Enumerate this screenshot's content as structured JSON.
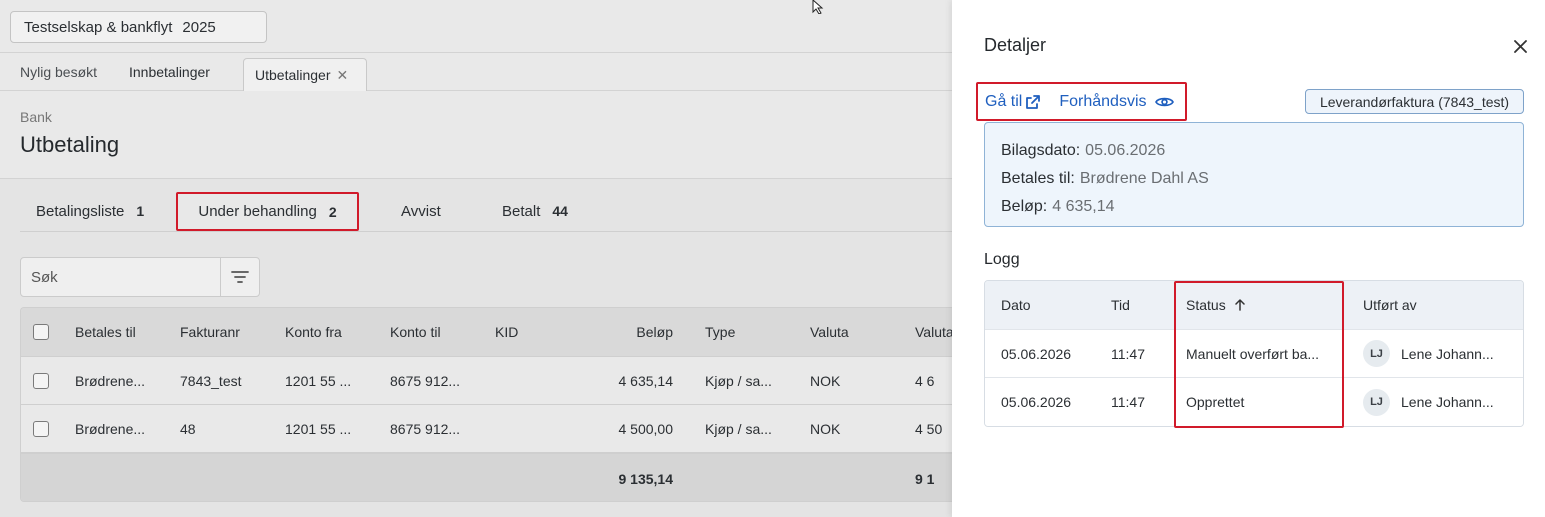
{
  "company": {
    "name": "Testselskap & bankflyt",
    "year": "2025"
  },
  "nav_tabs": [
    {
      "label": "Nylig besøkt"
    },
    {
      "label": "Innbetalinger"
    },
    {
      "label": "Utbetalinger"
    }
  ],
  "breadcrumb": "Bank",
  "page_title": "Utbetaling",
  "sub_tabs": [
    {
      "label": "Betalingsliste",
      "count": "1"
    },
    {
      "label": "Under behandling",
      "count": "2"
    },
    {
      "label": "Avvist",
      "count": ""
    },
    {
      "label": "Betalt",
      "count": "44"
    }
  ],
  "search": {
    "placeholder": "Søk"
  },
  "grid": {
    "columns": [
      "Betales til",
      "Fakturanr",
      "Konto fra",
      "Konto til",
      "KID",
      "Beløp",
      "Type",
      "Valuta",
      "Valuta"
    ],
    "rows": [
      {
        "betales_til": "Brødrene...",
        "fakturanr": "7843_test",
        "konto_fra": "1201 55 ...",
        "konto_til": "8675 912...",
        "kid": "",
        "belop": "4 635,14",
        "type": "Kjøp / sa...",
        "valuta": "NOK",
        "valuta2": "4 6"
      },
      {
        "betales_til": "Brødrene...",
        "fakturanr": "48",
        "konto_fra": "1201 55 ...",
        "konto_til": "8675 912...",
        "kid": "",
        "belop": "4 500,00",
        "type": "Kjøp / sa...",
        "valuta": "NOK",
        "valuta2": "4 50"
      }
    ],
    "sum": {
      "belop": "9 135,14",
      "valuta2": "9 1"
    }
  },
  "details": {
    "title": "Detaljer",
    "goto_label": "Gå til",
    "preview_label": "Forhåndsvis",
    "badge": "Leverandørfaktura (7843_test)",
    "info": [
      {
        "label": "Bilagsdato:",
        "value": "05.06.2026"
      },
      {
        "label": "Betales til:",
        "value": "Brødrene Dahl AS"
      },
      {
        "label": "Beløp:",
        "value": "4 635,14"
      }
    ],
    "log_title": "Logg",
    "log_columns": [
      "Dato",
      "Tid",
      "Status",
      "Utført av"
    ],
    "log_rows": [
      {
        "dato": "05.06.2026",
        "tid": "11:47",
        "status": "Manuelt overført ba...",
        "initials": "LJ",
        "user": "Lene Johann..."
      },
      {
        "dato": "05.06.2026",
        "tid": "11:47",
        "status": "Opprettet",
        "initials": "LJ",
        "user": "Lene Johann..."
      }
    ]
  },
  "colors": {
    "accent": "#1f5fbf",
    "highlight": "#d11a2a",
    "info_bg": "#eef5fc"
  }
}
